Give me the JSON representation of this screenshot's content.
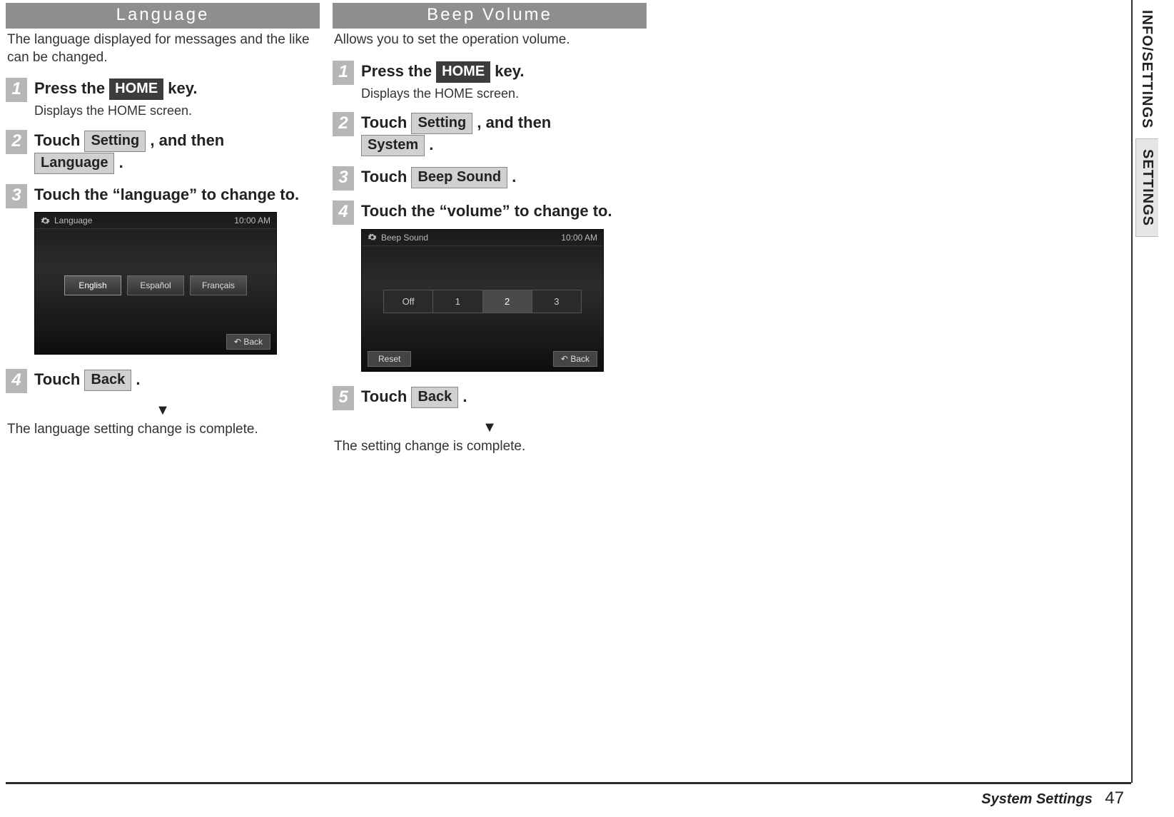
{
  "left": {
    "header": "Language",
    "intro": "The language displayed for messages and the like can be changed.",
    "steps": [
      {
        "num": "1",
        "title_pre": "Press the ",
        "key": "HOME",
        "title_post": " key.",
        "sub": "Displays the HOME screen."
      },
      {
        "num": "2",
        "title_pre": "Touch ",
        "key1": "Setting",
        "mid": " , and then ",
        "key2": "Language",
        "title_post": " ."
      },
      {
        "num": "3",
        "title": "Touch the “language” to change to."
      },
      {
        "num": "4",
        "title_pre": "Touch ",
        "key": "Back",
        "title_post": " ."
      }
    ],
    "screenshot": {
      "title": "Language",
      "time": "10:00 AM",
      "icons": "",
      "options": [
        "English",
        "Español",
        "Français"
      ],
      "back": "Back"
    },
    "result": "The language setting change is complete."
  },
  "right": {
    "header": "Beep Volume",
    "intro": "Allows you to set the operation volume.",
    "steps": [
      {
        "num": "1",
        "title_pre": "Press the ",
        "key": "HOME",
        "title_post": " key.",
        "sub": "Displays the HOME screen."
      },
      {
        "num": "2",
        "title_pre": "Touch ",
        "key1": "Setting",
        "mid": " , and then ",
        "key2": "System",
        "title_post": " ."
      },
      {
        "num": "3",
        "title_pre": "Touch ",
        "key": "Beep Sound",
        "title_post": " ."
      },
      {
        "num": "4",
        "title": "Touch the “volume” to change to."
      },
      {
        "num": "5",
        "title_pre": "Touch ",
        "key": "Back",
        "title_post": " ."
      }
    ],
    "screenshot": {
      "title": "Beep Sound",
      "time": "10:00 AM",
      "options": [
        "Off",
        "1",
        "2",
        "3"
      ],
      "selected_index": 2,
      "reset": "Reset",
      "back": "Back"
    },
    "result": "The setting change is complete."
  },
  "side_tabs": {
    "tab1": "INFO/SETTINGS",
    "tab2": "SETTINGS"
  },
  "footer": {
    "title": "System Settings",
    "page": "47"
  },
  "icons": {
    "back_arrow": "↶"
  }
}
